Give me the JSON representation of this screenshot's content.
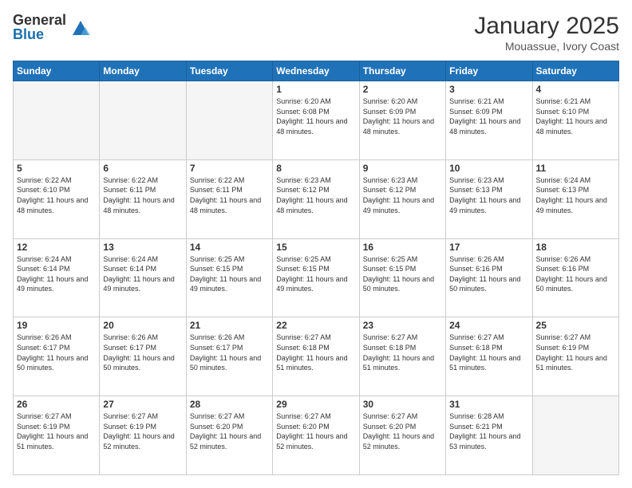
{
  "logo": {
    "general": "General",
    "blue": "Blue"
  },
  "header": {
    "month": "January 2025",
    "location": "Mouassue, Ivory Coast"
  },
  "weekdays": [
    "Sunday",
    "Monday",
    "Tuesday",
    "Wednesday",
    "Thursday",
    "Friday",
    "Saturday"
  ],
  "weeks": [
    [
      {
        "day": "",
        "empty": true
      },
      {
        "day": "",
        "empty": true
      },
      {
        "day": "",
        "empty": true
      },
      {
        "day": "1",
        "sunrise": "6:20 AM",
        "sunset": "6:08 PM",
        "daylight": "11 hours and 48 minutes."
      },
      {
        "day": "2",
        "sunrise": "6:20 AM",
        "sunset": "6:09 PM",
        "daylight": "11 hours and 48 minutes."
      },
      {
        "day": "3",
        "sunrise": "6:21 AM",
        "sunset": "6:09 PM",
        "daylight": "11 hours and 48 minutes."
      },
      {
        "day": "4",
        "sunrise": "6:21 AM",
        "sunset": "6:10 PM",
        "daylight": "11 hours and 48 minutes."
      }
    ],
    [
      {
        "day": "5",
        "sunrise": "6:22 AM",
        "sunset": "6:10 PM",
        "daylight": "11 hours and 48 minutes."
      },
      {
        "day": "6",
        "sunrise": "6:22 AM",
        "sunset": "6:11 PM",
        "daylight": "11 hours and 48 minutes."
      },
      {
        "day": "7",
        "sunrise": "6:22 AM",
        "sunset": "6:11 PM",
        "daylight": "11 hours and 48 minutes."
      },
      {
        "day": "8",
        "sunrise": "6:23 AM",
        "sunset": "6:12 PM",
        "daylight": "11 hours and 48 minutes."
      },
      {
        "day": "9",
        "sunrise": "6:23 AM",
        "sunset": "6:12 PM",
        "daylight": "11 hours and 49 minutes."
      },
      {
        "day": "10",
        "sunrise": "6:23 AM",
        "sunset": "6:13 PM",
        "daylight": "11 hours and 49 minutes."
      },
      {
        "day": "11",
        "sunrise": "6:24 AM",
        "sunset": "6:13 PM",
        "daylight": "11 hours and 49 minutes."
      }
    ],
    [
      {
        "day": "12",
        "sunrise": "6:24 AM",
        "sunset": "6:14 PM",
        "daylight": "11 hours and 49 minutes."
      },
      {
        "day": "13",
        "sunrise": "6:24 AM",
        "sunset": "6:14 PM",
        "daylight": "11 hours and 49 minutes."
      },
      {
        "day": "14",
        "sunrise": "6:25 AM",
        "sunset": "6:15 PM",
        "daylight": "11 hours and 49 minutes."
      },
      {
        "day": "15",
        "sunrise": "6:25 AM",
        "sunset": "6:15 PM",
        "daylight": "11 hours and 49 minutes."
      },
      {
        "day": "16",
        "sunrise": "6:25 AM",
        "sunset": "6:15 PM",
        "daylight": "11 hours and 50 minutes."
      },
      {
        "day": "17",
        "sunrise": "6:26 AM",
        "sunset": "6:16 PM",
        "daylight": "11 hours and 50 minutes."
      },
      {
        "day": "18",
        "sunrise": "6:26 AM",
        "sunset": "6:16 PM",
        "daylight": "11 hours and 50 minutes."
      }
    ],
    [
      {
        "day": "19",
        "sunrise": "6:26 AM",
        "sunset": "6:17 PM",
        "daylight": "11 hours and 50 minutes."
      },
      {
        "day": "20",
        "sunrise": "6:26 AM",
        "sunset": "6:17 PM",
        "daylight": "11 hours and 50 minutes."
      },
      {
        "day": "21",
        "sunrise": "6:26 AM",
        "sunset": "6:17 PM",
        "daylight": "11 hours and 50 minutes."
      },
      {
        "day": "22",
        "sunrise": "6:27 AM",
        "sunset": "6:18 PM",
        "daylight": "11 hours and 51 minutes."
      },
      {
        "day": "23",
        "sunrise": "6:27 AM",
        "sunset": "6:18 PM",
        "daylight": "11 hours and 51 minutes."
      },
      {
        "day": "24",
        "sunrise": "6:27 AM",
        "sunset": "6:18 PM",
        "daylight": "11 hours and 51 minutes."
      },
      {
        "day": "25",
        "sunrise": "6:27 AM",
        "sunset": "6:19 PM",
        "daylight": "11 hours and 51 minutes."
      }
    ],
    [
      {
        "day": "26",
        "sunrise": "6:27 AM",
        "sunset": "6:19 PM",
        "daylight": "11 hours and 51 minutes."
      },
      {
        "day": "27",
        "sunrise": "6:27 AM",
        "sunset": "6:19 PM",
        "daylight": "11 hours and 52 minutes."
      },
      {
        "day": "28",
        "sunrise": "6:27 AM",
        "sunset": "6:20 PM",
        "daylight": "11 hours and 52 minutes."
      },
      {
        "day": "29",
        "sunrise": "6:27 AM",
        "sunset": "6:20 PM",
        "daylight": "11 hours and 52 minutes."
      },
      {
        "day": "30",
        "sunrise": "6:27 AM",
        "sunset": "6:20 PM",
        "daylight": "11 hours and 52 minutes."
      },
      {
        "day": "31",
        "sunrise": "6:28 AM",
        "sunset": "6:21 PM",
        "daylight": "11 hours and 53 minutes."
      },
      {
        "day": "",
        "empty": true
      }
    ]
  ]
}
